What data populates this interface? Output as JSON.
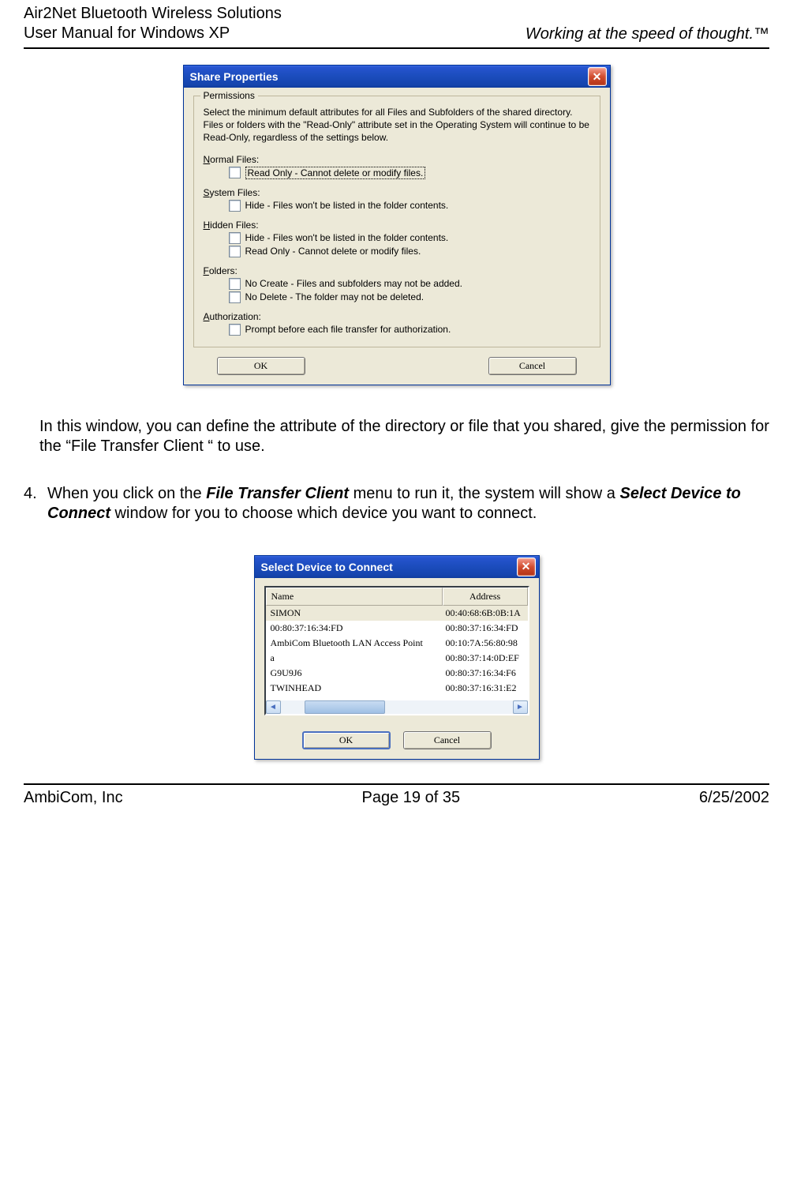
{
  "header": {
    "line1": "Air2Net Bluetooth Wireless Solutions",
    "line2": "User Manual for Windows XP",
    "tagline": "Working at the speed of thought.™"
  },
  "dialog1": {
    "title": "Share Properties",
    "close_glyph": "✕",
    "group_title": "Permissions",
    "description": "Select the minimum default attributes for all Files and Subfolders of the shared directory.  Files or folders with the \"Read-Only\" attribute set in the Operating System will continue to be Read-Only, regardless of the settings below.",
    "sections": {
      "normal_label": "Normal Files:",
      "normal_opt1": "Read Only - Cannot delete or modify files.",
      "system_label": "System Files:",
      "system_opt1": "Hide - Files won't be listed in the folder contents.",
      "hidden_label": "Hidden Files:",
      "hidden_opt1": "Hide - Files won't be listed in the folder contents.",
      "hidden_opt2": "Read Only - Cannot delete or modify files.",
      "folders_label": "Folders:",
      "folders_opt1": "No Create - Files and subfolders may not be added.",
      "folders_opt2": "No Delete - The folder may not be deleted.",
      "auth_label": "Authorization:",
      "auth_opt1": "Prompt before each file transfer for authorization."
    },
    "ok": "OK",
    "cancel": "Cancel"
  },
  "paragraph1": "In this window, you can define the attribute of the directory or file that you shared, give the permission for the “File Transfer Client “ to use.",
  "step4": {
    "num": "4.",
    "pre": "When you click on the ",
    "b1": "File Transfer Client",
    "mid": " menu to run it, the system will show a ",
    "b2": "Select Device to Connect",
    "post": " window for you to choose which device you want to connect."
  },
  "dialog2": {
    "title": "Select Device to Connect",
    "close_glyph": "✕",
    "col_name": "Name",
    "col_addr": "Address",
    "rows": [
      {
        "name": "SIMON",
        "addr": "00:40:68:6B:0B:1A"
      },
      {
        "name": "00:80:37:16:34:FD",
        "addr": "00:80:37:16:34:FD"
      },
      {
        "name": "AmbiCom Bluetooth LAN Access Point",
        "addr": "00:10:7A:56:80:98"
      },
      {
        "name": "a",
        "addr": "00:80:37:14:0D:EF"
      },
      {
        "name": "G9U9J6",
        "addr": "00:80:37:16:34:F6"
      },
      {
        "name": "TWINHEAD",
        "addr": "00:80:37:16:31:E2"
      }
    ],
    "ok": "OK",
    "cancel": "Cancel"
  },
  "footer": {
    "left": "AmbiCom, Inc",
    "center": "Page 19 of 35",
    "right": "6/25/2002"
  }
}
